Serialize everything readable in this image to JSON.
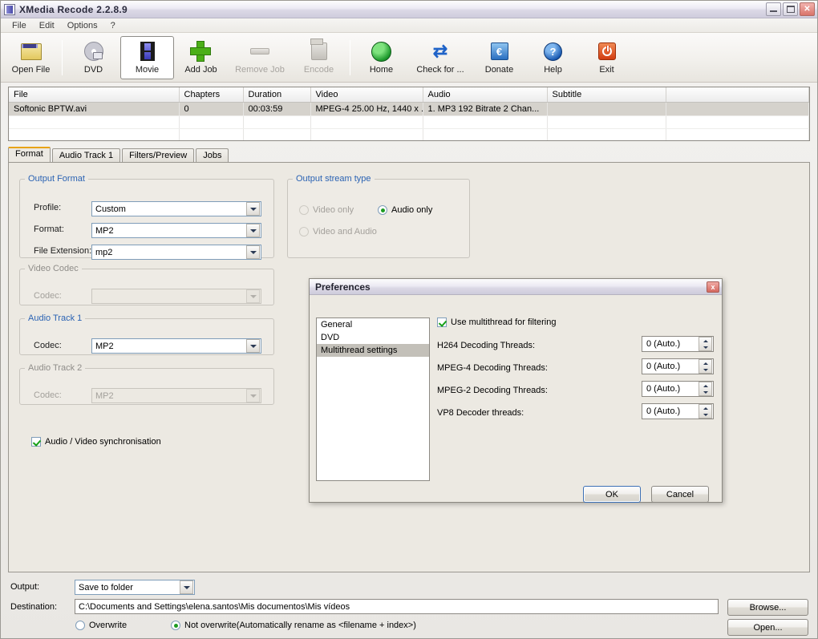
{
  "window": {
    "title": "XMedia Recode 2.2.8.9",
    "icon": "film-strip-icon",
    "minimize_label": "Minimize",
    "maximize_label": "Maximize",
    "close_label": "Close"
  },
  "menubar": {
    "items": [
      {
        "label": "File"
      },
      {
        "label": "Edit"
      },
      {
        "label": "Options"
      },
      {
        "label": "?"
      }
    ]
  },
  "toolbar": {
    "items": [
      {
        "label": "Open File",
        "icon": "open-file-icon",
        "state": "enabled"
      },
      {
        "label": "DVD",
        "icon": "dvd-disc-icon",
        "state": "enabled"
      },
      {
        "label": "Movie",
        "icon": "movie-film-icon",
        "state": "selected"
      },
      {
        "label": "Add Job",
        "icon": "plus-icon",
        "state": "enabled"
      },
      {
        "label": "Remove Job",
        "icon": "minus-bar-icon",
        "state": "disabled"
      },
      {
        "label": "Encode",
        "icon": "encode-icon",
        "state": "disabled"
      },
      {
        "label": "Home",
        "icon": "globe-icon",
        "state": "enabled"
      },
      {
        "label": "Check for ...",
        "icon": "refresh-arrows-icon",
        "state": "enabled"
      },
      {
        "label": "Donate",
        "icon": "euro-card-icon",
        "state": "enabled"
      },
      {
        "label": "Help",
        "icon": "question-mark-icon",
        "state": "enabled"
      },
      {
        "label": "Exit",
        "icon": "power-icon",
        "state": "enabled"
      }
    ]
  },
  "filelist": {
    "columns": [
      "File",
      "Chapters",
      "Duration",
      "Video",
      "Audio",
      "Subtitle",
      ""
    ],
    "rows": [
      {
        "file": "Softonic BPTW.avi",
        "chapters": "0",
        "duration": "00:03:59",
        "video": "MPEG-4 25.00 Hz, 1440 x ...",
        "audio": "1. MP3 192 Bitrate 2 Chan...",
        "subtitle": "",
        "extra": "",
        "selected": true
      }
    ]
  },
  "tabs": [
    {
      "label": "Format",
      "active": true
    },
    {
      "label": "Audio Track 1",
      "active": false
    },
    {
      "label": "Filters/Preview",
      "active": false
    },
    {
      "label": "Jobs",
      "active": false
    }
  ],
  "format_tab": {
    "output_format": {
      "legend": "Output Format",
      "profile_label": "Profile:",
      "profile_value": "Custom",
      "format_label": "Format:",
      "format_value": "MP2",
      "extension_label": "File Extension:",
      "extension_value": "mp2"
    },
    "output_stream_type": {
      "legend": "Output stream type",
      "options": [
        {
          "label": "Video only",
          "selected": false,
          "enabled": false
        },
        {
          "label": "Audio only",
          "selected": true,
          "enabled": true
        },
        {
          "label": "Video and Audio",
          "selected": false,
          "enabled": false
        }
      ]
    },
    "video_codec": {
      "legend": "Video Codec",
      "codec_label": "Codec:",
      "codec_value": "",
      "enabled": false
    },
    "audio_track_1": {
      "legend": "Audio Track 1",
      "codec_label": "Codec:",
      "codec_value": "MP2",
      "enabled": true
    },
    "audio_track_2": {
      "legend": "Audio Track 2",
      "codec_label": "Codec:",
      "codec_value": "MP2",
      "enabled": false
    },
    "av_sync": {
      "label": "Audio / Video synchronisation",
      "checked": true
    }
  },
  "preferences_dialog": {
    "title": "Preferences",
    "close_label": "x",
    "categories": [
      {
        "label": "General",
        "selected": false
      },
      {
        "label": "DVD",
        "selected": false
      },
      {
        "label": "Multithread settings",
        "selected": true
      }
    ],
    "multithread_checkbox": {
      "label": "Use multithread for filtering",
      "checked": true
    },
    "settings": [
      {
        "label": "H264 Decoding Threads:",
        "value": "0 (Auto.)"
      },
      {
        "label": "MPEG-4 Decoding Threads:",
        "value": "0 (Auto.)"
      },
      {
        "label": "MPEG-2 Decoding Threads:",
        "value": "0 (Auto.)"
      },
      {
        "label": "VP8 Decoder threads:",
        "value": "0 (Auto.)"
      }
    ],
    "ok_label": "OK",
    "cancel_label": "Cancel"
  },
  "output_section": {
    "output_label": "Output:",
    "output_value": "Save to folder",
    "destination_label": "Destination:",
    "destination_value": "C:\\Documents and Settings\\elena.santos\\Mis documentos\\Mis vídeos",
    "overwrite_option": {
      "label": "Overwrite",
      "selected": false
    },
    "not_overwrite_option": {
      "label": "Not overwrite(Automatically rename as <filename + index>)",
      "selected": true
    },
    "browse_label": "Browse...",
    "open_label": "Open..."
  },
  "colors": {
    "window_bg": "#ece9e2",
    "group_legend": "#2b63b3",
    "active_tab_accent": "#e8a317",
    "radio_selected": "#1d9b22",
    "selection_gray": "#c3c0b9"
  }
}
